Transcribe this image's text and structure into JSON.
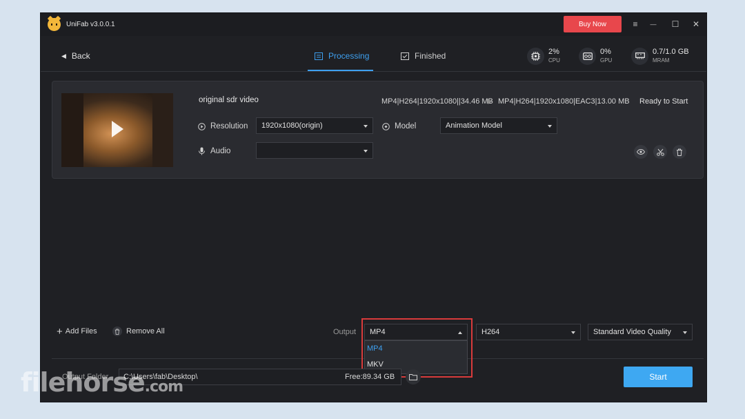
{
  "app": {
    "title": "UniFab v3.0.0.1",
    "buy_label": "Buy Now"
  },
  "window_controls": {
    "menu": "≡",
    "minimize": "—",
    "maximize": "☐",
    "close": "✕"
  },
  "nav": {
    "back_label": "Back",
    "tabs": [
      {
        "label": "Processing",
        "active": true
      },
      {
        "label": "Finished",
        "active": false
      }
    ]
  },
  "stats": {
    "cpu": {
      "value": "2%",
      "label": "CPU"
    },
    "gpu": {
      "value": "0%",
      "label": "GPU"
    },
    "mram": {
      "value": "0.7/1.0 GB",
      "label": "MRAM"
    }
  },
  "task": {
    "name": "original sdr video",
    "resolution_label": "Resolution",
    "resolution_value": "1920x1080(origin)",
    "audio_label": "Audio",
    "audio_value": "",
    "model_label": "Model",
    "model_value": "Animation Model",
    "source_format": "MP4|H264|1920x1080||34.46 MB",
    "target_format": "MP4|H264|1920x1080|EAC3|13.00 MB",
    "status": "Ready to Start"
  },
  "bottom": {
    "add_files": "Add Files",
    "remove_all": "Remove All",
    "output_label": "Output",
    "format_selected": "MP4",
    "format_options": [
      "MP4",
      "MKV"
    ],
    "codec_value": "H264",
    "quality_value": "Standard Video Quality",
    "output_folder_label": "Output Folder",
    "output_path": "C:\\Users\\fab\\Desktop\\",
    "free_space": "Free:89.34 GB",
    "start_label": "Start"
  },
  "watermark": {
    "text": "filehorse",
    "suffix": ".com"
  },
  "colors": {
    "accent": "#3ea0f0",
    "buy": "#e8474c",
    "highlight": "#d93b3b",
    "window_bg": "#1f2024"
  }
}
